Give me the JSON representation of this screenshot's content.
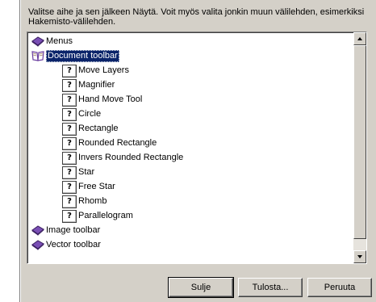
{
  "instructions": "Valitse aihe ja sen jälkeen Näytä. Voit myös valita jonkin muun välilehden, esimerkiksi Hakemisto-välilehden.",
  "topics": [
    {
      "label": "Menus",
      "icon": "closed-book-icon",
      "level": 0,
      "selected": false
    },
    {
      "label": "Document toolbar",
      "icon": "open-book-icon",
      "level": 0,
      "selected": true
    },
    {
      "label": "Move Layers",
      "icon": "help-topic-icon",
      "level": 1,
      "selected": false
    },
    {
      "label": "Magnifier",
      "icon": "help-topic-icon",
      "level": 1,
      "selected": false
    },
    {
      "label": "Hand Move Tool",
      "icon": "help-topic-icon",
      "level": 1,
      "selected": false
    },
    {
      "label": "Circle",
      "icon": "help-topic-icon",
      "level": 1,
      "selected": false
    },
    {
      "label": "Rectangle",
      "icon": "help-topic-icon",
      "level": 1,
      "selected": false
    },
    {
      "label": "Rounded Rectangle",
      "icon": "help-topic-icon",
      "level": 1,
      "selected": false
    },
    {
      "label": "Invers Rounded Rectangle",
      "icon": "help-topic-icon",
      "level": 1,
      "selected": false
    },
    {
      "label": "Star",
      "icon": "help-topic-icon",
      "level": 1,
      "selected": false
    },
    {
      "label": "Free Star",
      "icon": "help-topic-icon",
      "level": 1,
      "selected": false
    },
    {
      "label": "Rhomb",
      "icon": "help-topic-icon",
      "level": 1,
      "selected": false
    },
    {
      "label": "Parallelogram",
      "icon": "help-topic-icon",
      "level": 1,
      "selected": false
    },
    {
      "label": "Image toolbar",
      "icon": "closed-book-icon",
      "level": 0,
      "selected": false
    },
    {
      "label": "Vector toolbar",
      "icon": "closed-book-icon",
      "level": 0,
      "selected": false
    }
  ],
  "buttons": {
    "close": "Sulje",
    "print": "Tulosta...",
    "cancel": "Peruuta"
  },
  "colors": {
    "dialog_bg": "#d4d0c8",
    "selection_bg": "#0a246a",
    "book_purple": "#6b3fa0"
  }
}
